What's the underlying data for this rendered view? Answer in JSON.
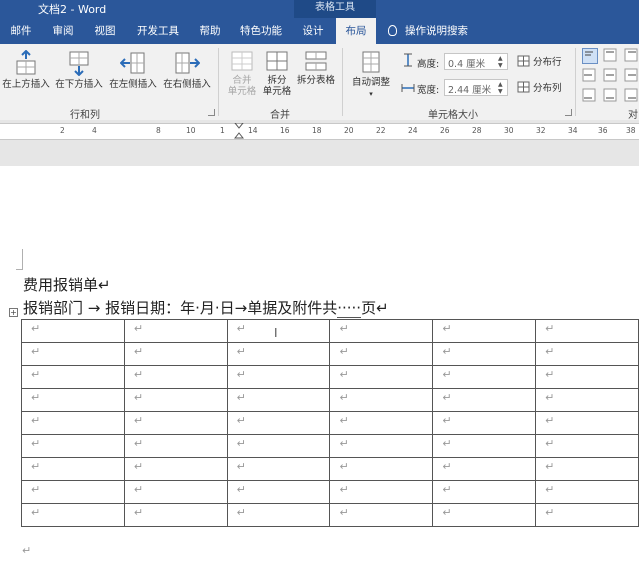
{
  "title_bar": {
    "doc_title": "文档2 - Word",
    "context_label": "表格工具"
  },
  "tabs": [
    "邮件",
    "审阅",
    "视图",
    "开发工具",
    "帮助",
    "特色功能",
    "设计",
    "布局"
  ],
  "active_tab": "布局",
  "tell_me": "操作说明搜索",
  "ribbon": {
    "rows_cols": {
      "insert_above": "在上方插入",
      "insert_below": "在下方插入",
      "insert_left": "在左侧插入",
      "insert_right": "在右侧插入",
      "group_label": "行和列"
    },
    "merge": {
      "merge_cells_1": "合并",
      "merge_cells_2": "单元格",
      "split_cells_1": "拆分",
      "split_cells_2": "单元格",
      "split_table": "拆分表格",
      "group_label": "合并"
    },
    "cell_size": {
      "autofit": "自动调整",
      "height_label": "高度:",
      "height_value": "0.4 厘米",
      "width_label": "宽度:",
      "width_value": "2.44 厘米",
      "distribute_rows": "分布行",
      "distribute_cols": "分布列",
      "group_label": "单元格大小"
    },
    "alignment": {
      "group_label_partial": "对"
    }
  },
  "ruler": {
    "numbers": [
      "2",
      "4",
      "8",
      "10",
      "1",
      "14",
      "16",
      "18",
      "20",
      "22",
      "24",
      "26",
      "28",
      "30",
      "32",
      "34",
      "36",
      "38"
    ]
  },
  "document": {
    "title": "费用报销单↵",
    "subtitle": {
      "part1": "报销部门 → 报销日期：年·月·日→单据及附件共",
      "blank": "·····",
      "part2": "页↵"
    },
    "table": {
      "rows": 9,
      "cols": 6,
      "cell_mark": "↵"
    },
    "after_table_mark": "↵"
  }
}
